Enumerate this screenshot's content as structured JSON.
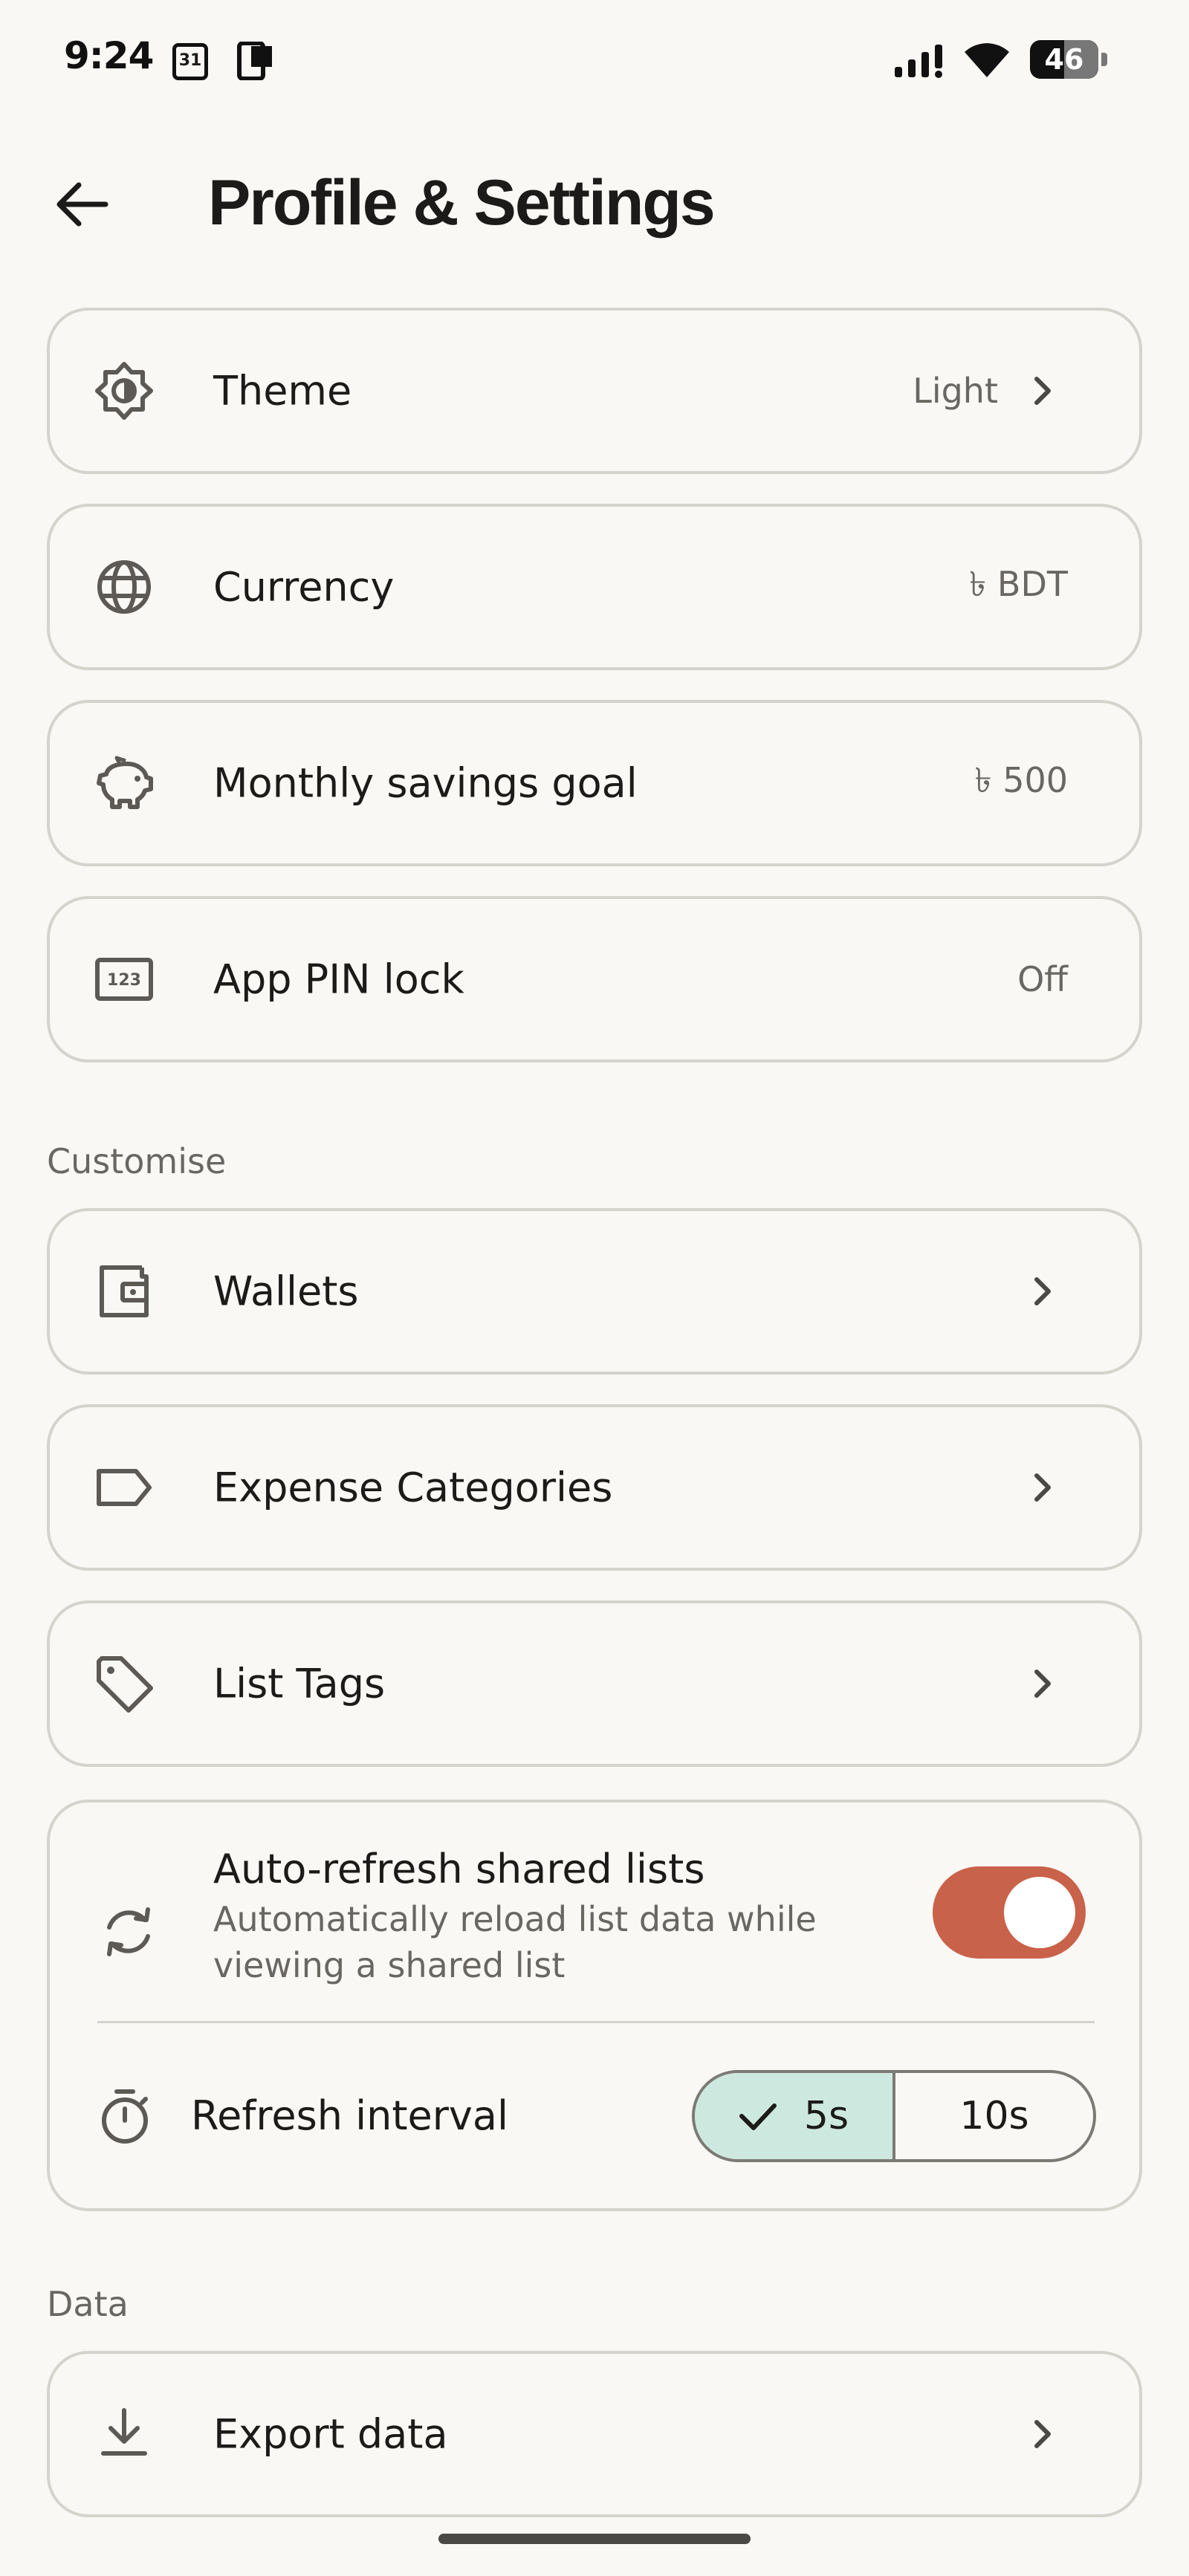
{
  "status_bar": {
    "time": "9:24",
    "calendar_day": "31",
    "battery": "46"
  },
  "header": {
    "title": "Profile & Settings",
    "back_icon": "arrow-left-icon"
  },
  "settings": [
    {
      "label": "Theme",
      "value": "Light",
      "icon": "theme-brightness-icon",
      "chevron": true
    },
    {
      "label": "Currency",
      "value": "৳ BDT",
      "icon": "globe-icon",
      "chevron": false
    },
    {
      "label": "Monthly savings goal",
      "value": "৳ 500",
      "icon": "piggy-bank-icon",
      "chevron": false
    },
    {
      "label": "App PIN lock",
      "value": "Off",
      "icon": "pin-123-icon",
      "chevron": false
    }
  ],
  "customise": {
    "section_label": "Customise",
    "items": [
      {
        "label": "Wallets",
        "icon": "wallet-icon"
      },
      {
        "label": "Expense Categories",
        "icon": "label-outline-icon"
      },
      {
        "label": "List Tags",
        "icon": "tag-icon"
      }
    ],
    "auto_refresh": {
      "title": "Auto-refresh shared lists",
      "description": "Automatically reload list data while viewing a shared list",
      "enabled": true,
      "icon": "sync-icon"
    },
    "refresh_interval": {
      "label": "Refresh interval",
      "icon": "timer-icon",
      "options": [
        "5s",
        "10s"
      ],
      "selected": "5s"
    }
  },
  "data_section": {
    "section_label": "Data",
    "items": [
      {
        "label": "Export data",
        "icon": "download-icon"
      }
    ]
  },
  "colors": {
    "background": "#f9f8f5",
    "card_border": "#d6d3cd",
    "toggle_on": "#c9624a",
    "segment_selected": "#cde8df"
  }
}
